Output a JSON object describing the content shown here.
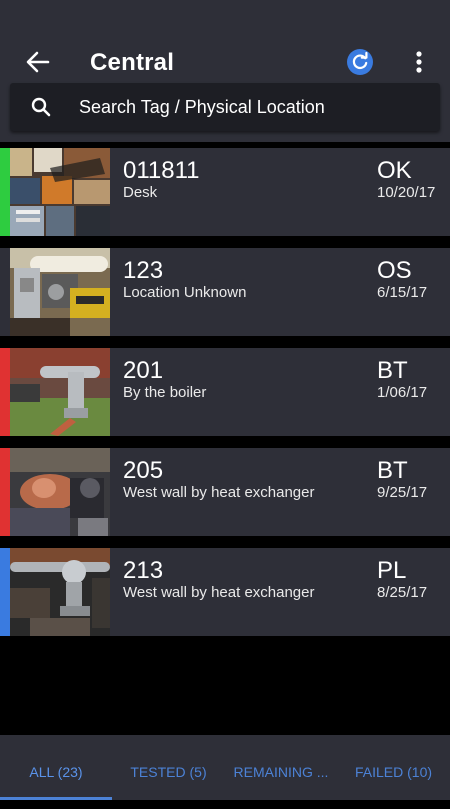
{
  "appbar": {
    "title": "Central",
    "search_text": "Search Tag / Physical Location",
    "accent": "#3a7be0"
  },
  "items": [
    {
      "tag": "011811",
      "location": "Desk",
      "status": "OK",
      "date": "10/20/17",
      "stripe": "#2ecc40"
    },
    {
      "tag": "123",
      "location": "Location Unknown",
      "status": "OS",
      "date": "6/15/17",
      "stripe": "none"
    },
    {
      "tag": "201",
      "location": "By the boiler",
      "status": "BT",
      "date": "1/06/17",
      "stripe": "#e03232"
    },
    {
      "tag": "205",
      "location": "West wall by heat exchanger",
      "status": "BT",
      "date": "9/25/17",
      "stripe": "#e03232"
    },
    {
      "tag": "213",
      "location": "West wall by heat exchanger",
      "status": "PL",
      "date": "8/25/17",
      "stripe": "#3a7be0"
    }
  ],
  "tabs": [
    {
      "label": "ALL (23)",
      "active": true
    },
    {
      "label": "TESTED (5)",
      "active": false
    },
    {
      "label": "REMAINING ...",
      "active": false
    },
    {
      "label": "FAILED (10)",
      "active": false
    }
  ],
  "icons": [
    "back-arrow-icon",
    "refresh-icon",
    "more-vert-icon",
    "search-icon"
  ]
}
